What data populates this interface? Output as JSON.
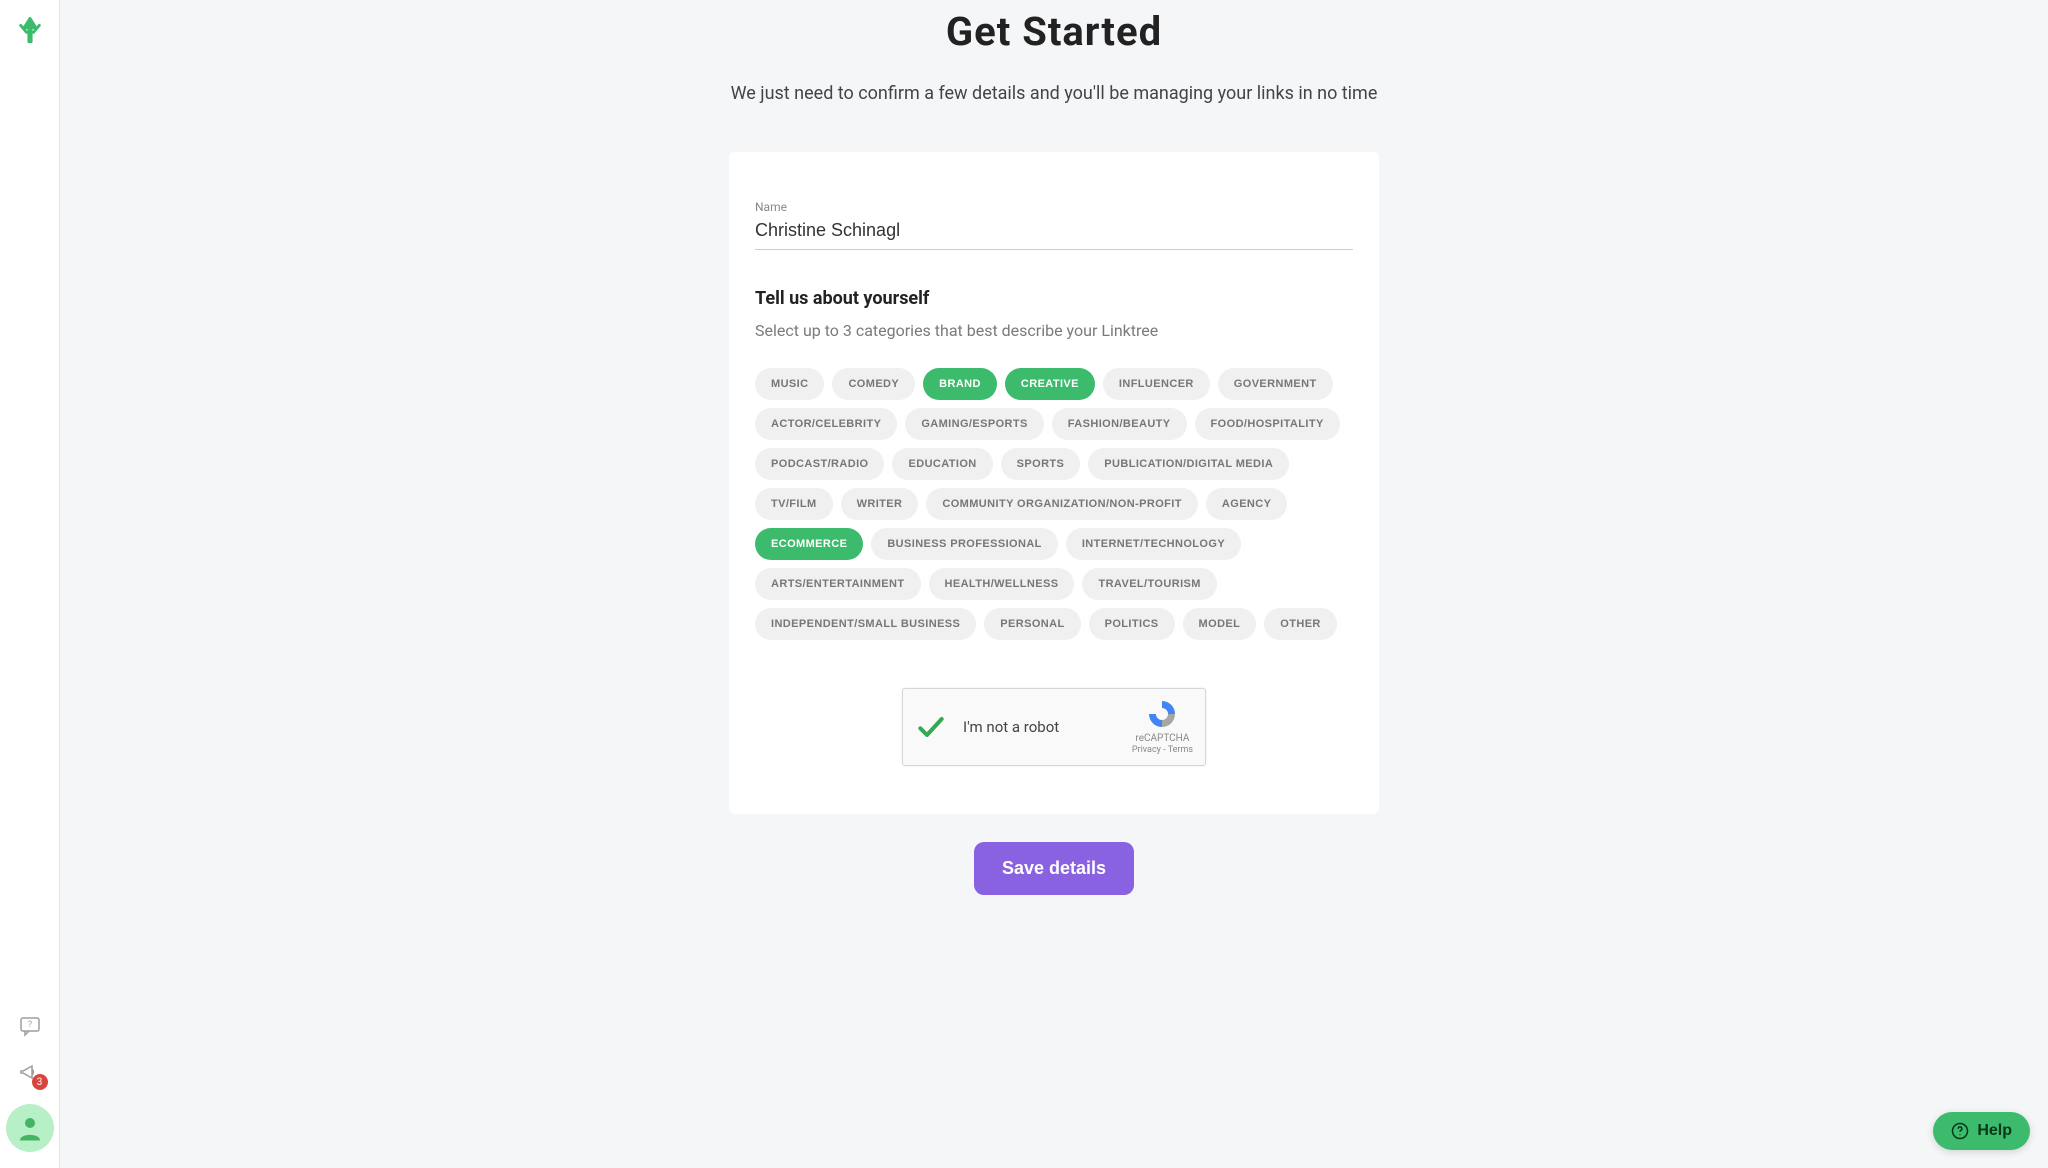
{
  "sidebar": {
    "notification_count": "3"
  },
  "header": {
    "title": "Get Started",
    "subtitle": "We just need to confirm a few details and you'll be managing your links in no time"
  },
  "form": {
    "name_label": "Name",
    "name_value": "Christine Schinagl",
    "about_title": "Tell us about yourself",
    "about_subtitle": "Select up to 3 categories that best describe your Linktree",
    "categories": [
      {
        "label": "MUSIC",
        "selected": false
      },
      {
        "label": "COMEDY",
        "selected": false
      },
      {
        "label": "BRAND",
        "selected": true
      },
      {
        "label": "CREATIVE",
        "selected": true
      },
      {
        "label": "INFLUENCER",
        "selected": false
      },
      {
        "label": "GOVERNMENT",
        "selected": false
      },
      {
        "label": "ACTOR/CELEBRITY",
        "selected": false
      },
      {
        "label": "GAMING/ESPORTS",
        "selected": false
      },
      {
        "label": "FASHION/BEAUTY",
        "selected": false
      },
      {
        "label": "FOOD/HOSPITALITY",
        "selected": false
      },
      {
        "label": "PODCAST/RADIO",
        "selected": false
      },
      {
        "label": "EDUCATION",
        "selected": false
      },
      {
        "label": "SPORTS",
        "selected": false
      },
      {
        "label": "PUBLICATION/DIGITAL MEDIA",
        "selected": false
      },
      {
        "label": "TV/FILM",
        "selected": false
      },
      {
        "label": "WRITER",
        "selected": false
      },
      {
        "label": "COMMUNITY ORGANIZATION/NON-PROFIT",
        "selected": false
      },
      {
        "label": "AGENCY",
        "selected": false
      },
      {
        "label": "ECOMMERCE",
        "selected": true
      },
      {
        "label": "BUSINESS PROFESSIONAL",
        "selected": false
      },
      {
        "label": "INTERNET/TECHNOLOGY",
        "selected": false
      },
      {
        "label": "ARTS/ENTERTAINMENT",
        "selected": false
      },
      {
        "label": "HEALTH/WELLNESS",
        "selected": false
      },
      {
        "label": "TRAVEL/TOURISM",
        "selected": false
      },
      {
        "label": "INDEPENDENT/SMALL BUSINESS",
        "selected": false
      },
      {
        "label": "PERSONAL",
        "selected": false
      },
      {
        "label": "POLITICS",
        "selected": false
      },
      {
        "label": "MODEL",
        "selected": false
      },
      {
        "label": "OTHER",
        "selected": false
      }
    ]
  },
  "recaptcha": {
    "label": "I'm not a robot",
    "brand": "reCAPTCHA",
    "links": "Privacy - Terms"
  },
  "actions": {
    "save_label": "Save details"
  },
  "help": {
    "label": "Help"
  }
}
